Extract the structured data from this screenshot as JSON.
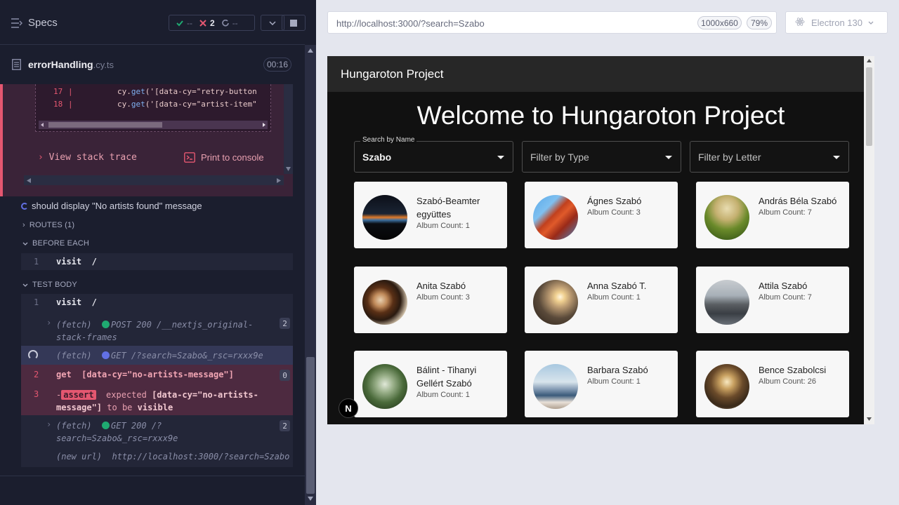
{
  "reporter": {
    "title": "Specs",
    "stats": {
      "passed": "--",
      "failed": "2",
      "pending": "--"
    },
    "file": {
      "name": "errorHandling",
      "ext": ".cy.ts",
      "duration": "00:16"
    },
    "code_lines": [
      {
        "num": "17",
        "code_prefix": "cy.",
        "code_fn": "get",
        "code_rest": "('[data-cy=\"retry-button"
      },
      {
        "num": "18",
        "code_prefix": "cy.",
        "code_fn": "get",
        "code_rest": "('[data-cy=\"artist-item\""
      }
    ],
    "view_stack": "View stack trace",
    "print_console": "Print to console",
    "test_title": "should display \"No artists found\" message",
    "routes": "ROUTES (1)",
    "before_each": "BEFORE EACH",
    "test_body": "TEST BODY",
    "before_each_cmds": [
      {
        "num": "1",
        "name": "visit",
        "arg": "/"
      }
    ],
    "body_cmds": {
      "c1": {
        "num": "1",
        "name": "visit",
        "arg": "/"
      },
      "fetch1": {
        "kind": "(fetch)",
        "text_a": "POST 200 /__nextjs_original-",
        "text_b": "stack-frames",
        "badge": "2"
      },
      "fetch2": {
        "kind": "(fetch)",
        "text": "GET /?search=Szabo&_rsc=rxxx9e"
      },
      "c2": {
        "num": "2",
        "name": "get",
        "arg": "[data-cy=\"no-artists-message\"]",
        "badge": "0"
      },
      "c3": {
        "num": "3",
        "prefix": "-",
        "tag": "assert",
        "text_a": "expected",
        "text_b": "[data-cy=\"no-artists-",
        "text_c": "message\"]",
        "text_d": "to be",
        "text_e": "visible"
      },
      "fetch3": {
        "kind": "(fetch)",
        "text_a": "GET 200 /?",
        "text_b": "search=Szabo&_rsc=rxxx9e",
        "badge": "2"
      },
      "newurl": {
        "kind": "(new url)",
        "text": "http://localhost:3000/?search=Szabo"
      }
    }
  },
  "browser": {
    "url": "http://localhost:3000/?search=Szabo",
    "viewport": "1000x660",
    "zoom": "79%",
    "name": "Electron 130"
  },
  "app": {
    "brand": "Hungaroton Project",
    "heading": "Welcome to Hungaroton Project",
    "filters": {
      "name": {
        "label": "Search by Name",
        "value": "Szabo"
      },
      "type": {
        "placeholder": "Filter by Type"
      },
      "letter": {
        "placeholder": "Filter by Letter"
      }
    },
    "artists": [
      {
        "name": "Szabó-Beamter együttes",
        "album_count": "Album Count: 1"
      },
      {
        "name": "Ágnes Szabó",
        "album_count": "Album Count: 3"
      },
      {
        "name": "András Béla Szabó",
        "album_count": "Album Count: 7"
      },
      {
        "name": "Anita Szabó",
        "album_count": "Album Count: 3"
      },
      {
        "name": "Anna Szabó T.",
        "album_count": "Album Count: 1"
      },
      {
        "name": "Attila Szabó",
        "album_count": "Album Count: 7"
      },
      {
        "name": "Bálint - Tihanyi Gellért Szabó",
        "album_count": "Album Count: 1"
      },
      {
        "name": "Barbara Szabó",
        "album_count": "Album Count: 1"
      },
      {
        "name": "Bence Szabolcsi",
        "album_count": "Album Count: 26"
      }
    ]
  },
  "colors": {
    "failed": "#e45770",
    "passed": "#1fa971",
    "running": "#6270e4",
    "app_bg": "#111111",
    "card_bg": "#f7f7f7"
  }
}
